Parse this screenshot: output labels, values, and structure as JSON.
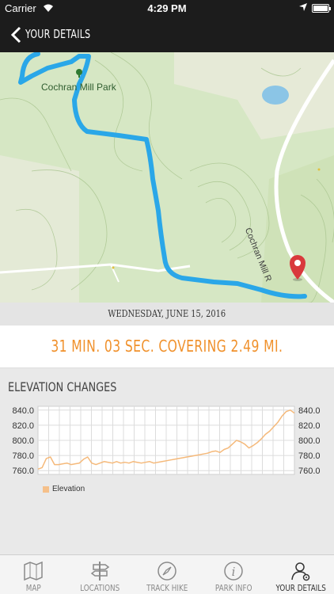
{
  "status_bar": {
    "carrier": "Carrier",
    "time": "4:29 PM"
  },
  "nav": {
    "title": "YOUR DETAILS"
  },
  "map": {
    "park_label": "Cochran Mill Park",
    "road_label": "Cochran Mill R",
    "route_color": "#2aa7e8"
  },
  "hike": {
    "date": "WEDNESDAY, JUNE 15, 2016",
    "summary": "31 MIN. 03 SEC. COVERING 2.49 MI."
  },
  "elevation": {
    "heading": "ELEVATION CHANGES",
    "legend": "Elevation"
  },
  "chart_data": {
    "type": "line",
    "title": "",
    "xlabel": "",
    "ylabel": "",
    "ylim": [
      755,
      845
    ],
    "yticks": [
      "840.0",
      "820.0",
      "800.0",
      "780.0",
      "760.0"
    ],
    "grid": true,
    "series": [
      {
        "name": "Elevation",
        "color": "#f5b97a",
        "values": [
          762,
          764,
          776,
          778,
          768,
          768,
          769,
          770,
          768,
          769,
          770,
          775,
          778,
          770,
          768,
          770,
          772,
          771,
          770,
          772,
          770,
          771,
          770,
          772,
          771,
          770,
          771,
          772,
          770,
          771,
          772,
          773,
          774,
          775,
          776,
          777,
          778,
          779,
          780,
          781,
          782,
          783,
          785,
          786,
          784,
          788,
          790,
          795,
          800,
          798,
          795,
          790,
          793,
          797,
          802,
          808,
          812,
          818,
          824,
          832,
          838,
          840,
          836
        ]
      }
    ]
  },
  "tabs": [
    {
      "label": "MAP",
      "icon": "map-icon"
    },
    {
      "label": "LOCATIONS",
      "icon": "signpost-icon"
    },
    {
      "label": "TRACK HIKE",
      "icon": "compass-icon"
    },
    {
      "label": "PARK INFO",
      "icon": "info-icon"
    },
    {
      "label": "YOUR DETAILS",
      "icon": "user-settings-icon"
    }
  ]
}
